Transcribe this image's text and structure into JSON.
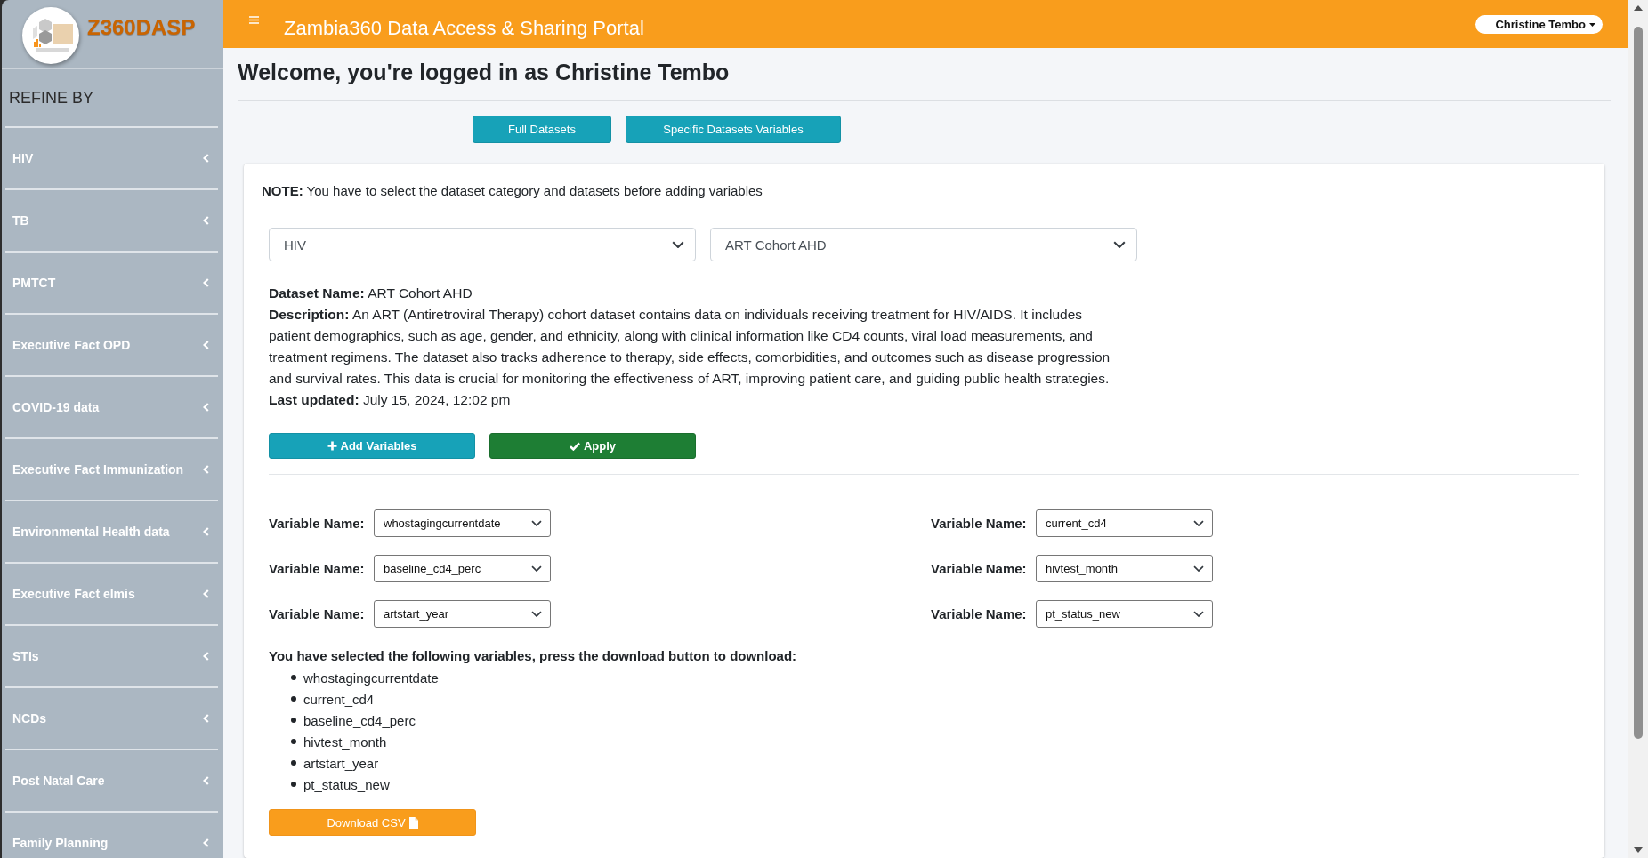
{
  "sidebar": {
    "brand": "Z360DASP",
    "heading": "REFINE BY",
    "items": [
      {
        "label": "HIV",
        "expanded": false
      },
      {
        "label": "TB",
        "expanded": false
      },
      {
        "label": "PMTCT",
        "expanded": false
      },
      {
        "label": "Executive Fact OPD",
        "expanded": false
      },
      {
        "label": "COVID-19 data",
        "expanded": false
      },
      {
        "label": "Executive Fact Immunization",
        "expanded": false
      },
      {
        "label": "Environmental Health data",
        "expanded": false
      },
      {
        "label": "Executive Fact elmis",
        "expanded": false
      },
      {
        "label": "STIs",
        "expanded": false
      },
      {
        "label": "NCDs",
        "expanded": false
      },
      {
        "label": "Post Natal Care",
        "expanded": false
      },
      {
        "label": "Family Planning",
        "expanded": false
      }
    ]
  },
  "header": {
    "title": "Zambia360 Data Access & Sharing Portal",
    "user_menu": "Christine Tembo"
  },
  "welcome": "Welcome, you're logged in as Christine Tembo",
  "mode_buttons": [
    "Full Datasets",
    "Specific Datasets Variables"
  ],
  "note": "**NOTE:** You have to select the dataset category and datasets before adding variables",
  "category_select": {
    "value": "HIV"
  },
  "dataset_select": {
    "value": "ART Cohort AHD"
  },
  "dataset_details": [
    "**Dataset Name:** ART Cohort AHD",
    "**Description:** An ART (Antiretroviral Therapy) cohort dataset contains data on individuals receiving treatment for HIV/AIDS. It includes patient demographics, such as age, gender, and ethnicity, along with clinical information like CD4 counts, viral load measurements, and treatment regimens. The dataset also tracks adherence to therapy, side effects, comorbidities, and outcomes such as disease progression and survival rates. This data is crucial for monitoring the effectiveness of ART, improving patient care, and guiding public health strategies.",
    "**Last updated:** July 15, 2024, 12:02 pm"
  ],
  "actions": [
    {
      "kind": "add",
      "label": "Add Variables"
    },
    {
      "kind": "apply",
      "label": "Apply"
    }
  ],
  "variables": [
    {
      "label": "Variable Name:",
      "value": "whostagingcurrentdate"
    },
    {
      "label": "Variable Name:",
      "value": "current_cd4"
    },
    {
      "label": "Variable Name:",
      "value": "baseline_cd4_perc"
    },
    {
      "label": "Variable Name:",
      "value": "hivtest_month"
    },
    {
      "label": "Variable Name:",
      "value": "artstart_year"
    },
    {
      "label": "Variable Name:",
      "value": "pt_status_new"
    }
  ],
  "selected_heading": "You have selected the following variables, press the download button to download:",
  "selected_variables": [
    "whostagingcurrentdate",
    "current_cd4",
    "baseline_cd4_perc",
    "hivtest_month",
    "artstart_year",
    "pt_status_new"
  ],
  "download_button": "Download CSV"
}
